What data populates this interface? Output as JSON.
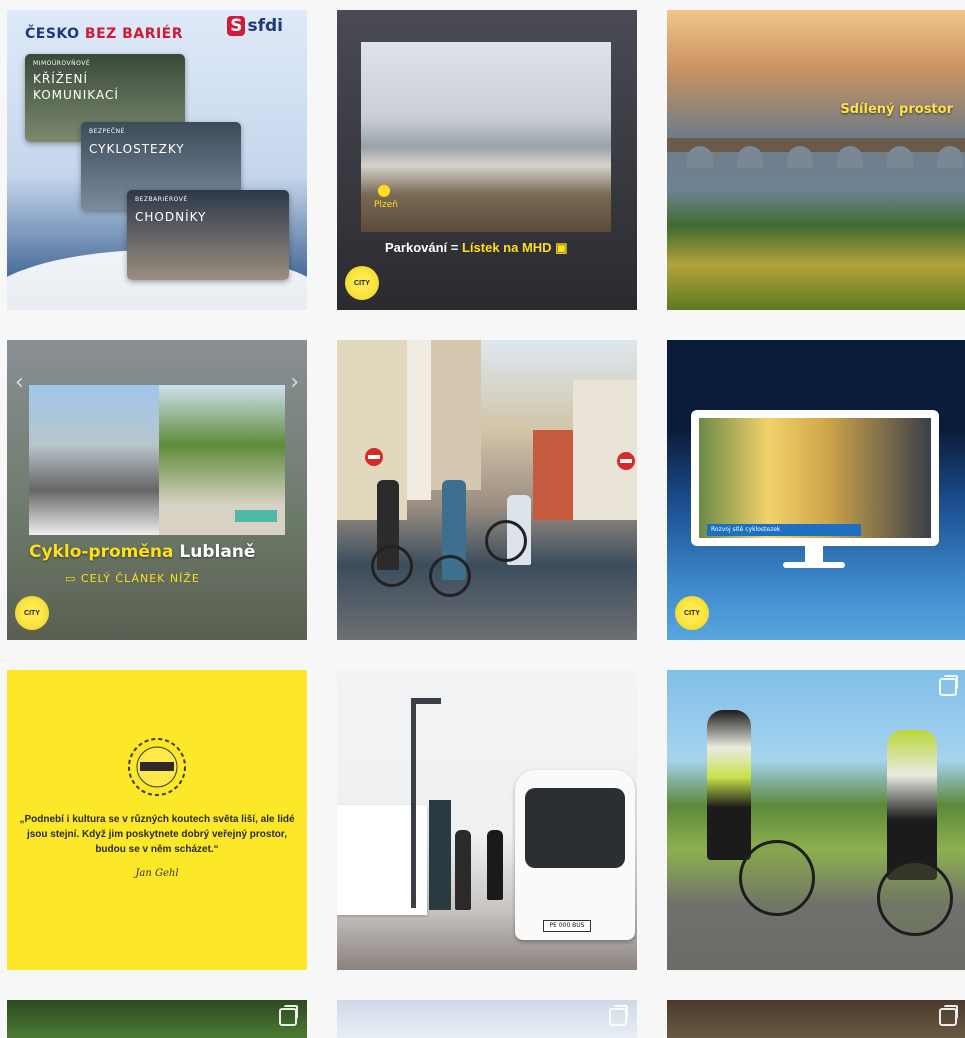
{
  "posts": {
    "p1": {
      "title_part1": "ČESKO",
      "title_part2": "BEZ BARIÉR",
      "logo_text": "sfdi",
      "card1_small": "MIMOÚROVŇOVÉ",
      "card1_big_line1": "KŘÍŽENÍ",
      "card1_big_line2": "KOMUNIKACÍ",
      "card2_small": "BEZPEČNÉ",
      "card2_big": "CYKLOSTEZKY",
      "card3_small": "BEZBARIÉROVÉ",
      "card3_big": "CHODNÍKY"
    },
    "p2": {
      "city": "Plzeň",
      "caption_part1": "Parkování =",
      "caption_part2": "Lístek na MHD"
    },
    "p3": {
      "label": "Sdílený prostor"
    },
    "p4": {
      "title_part1": "Cyklo-proměna",
      "title_part2": "Lublaně",
      "subtitle": "CELÝ ČLÁNEK NÍŽE"
    },
    "p6": {
      "bar_text": "Rozvoj sítě cyklostezek"
    },
    "p7": {
      "quote": "„Podnebí i kultura se v různých koutech světa liší, ale lidé jsou stejní. Když jim poskytnete dobrý veřejný prostor, budou se v něm scházet.“",
      "signature": "Jan Gehl"
    },
    "p8": {
      "plate": "PE 000 BUS"
    }
  },
  "brand": {
    "badge_text": "CITYchangers",
    "accent_yellow": "#ffde1a",
    "accent_red": "#d11a3a",
    "accent_navy": "#1f3a78"
  },
  "icons": {
    "multi_post": "carousel-icon",
    "location": "location-pin-icon",
    "bus": "bus-icon",
    "article": "article-icon"
  }
}
